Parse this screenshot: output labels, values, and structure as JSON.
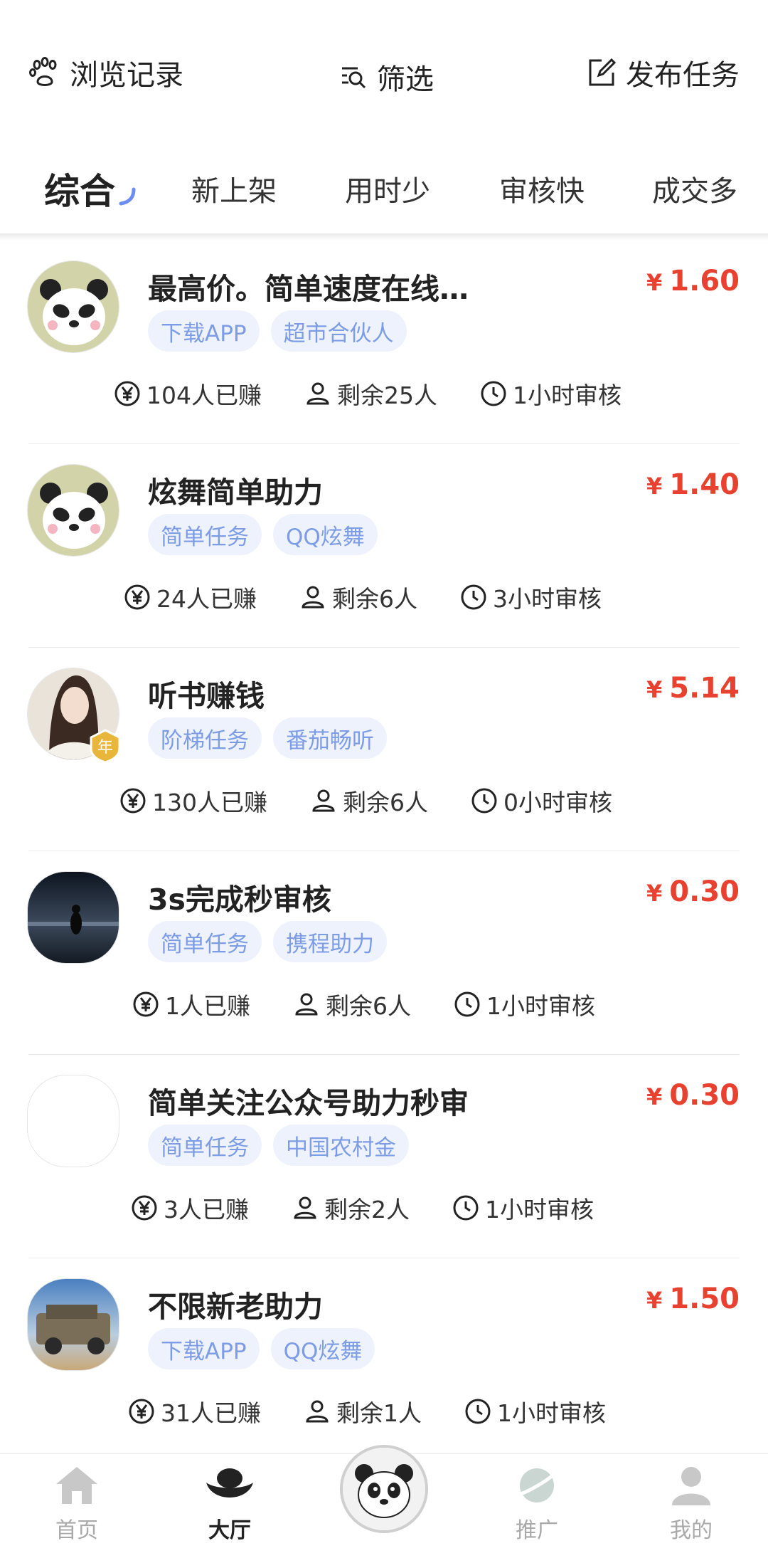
{
  "topbar": {
    "history_label": "浏览记录",
    "filter_label": "筛选",
    "publish_label": "发布任务"
  },
  "tabs": [
    {
      "label": "综合",
      "active": true
    },
    {
      "label": "新上架",
      "active": false
    },
    {
      "label": "用时少",
      "active": false
    },
    {
      "label": "审核快",
      "active": false
    },
    {
      "label": "成交多",
      "active": false
    }
  ],
  "currency_symbol": "¥",
  "tasks": [
    {
      "title": "最高价。简单速度在线…",
      "price": "1.60",
      "tags": [
        "下载APP",
        "超市合伙人"
      ],
      "earned": "104人已赚",
      "remaining": "剩余25人",
      "review": "1小时审核",
      "avatar": "panda"
    },
    {
      "title": "炫舞简单助力",
      "price": "1.40",
      "tags": [
        "简单任务",
        "QQ炫舞"
      ],
      "earned": "24人已赚",
      "remaining": "剩余6人",
      "review": "3小时审核",
      "avatar": "panda"
    },
    {
      "title": "听书赚钱",
      "price": "5.14",
      "tags": [
        "阶梯任务",
        "番茄畅听"
      ],
      "earned": "130人已赚",
      "remaining": "剩余6人",
      "review": "0小时审核",
      "avatar": "girl-photo",
      "badge": "vip-badge"
    },
    {
      "title": "3s完成秒审核",
      "price": "0.30",
      "tags": [
        "简单任务",
        "携程助力"
      ],
      "earned": "1人已赚",
      "remaining": "剩余6人",
      "review": "1小时审核",
      "avatar": "night-sky-photo"
    },
    {
      "title": "简单关注公众号助力秒审",
      "price": "0.30",
      "tags": [
        "简单任务",
        "中国农村金"
      ],
      "earned": "3人已赚",
      "remaining": "剩余2人",
      "review": "1小时审核",
      "avatar": "blank"
    },
    {
      "title": "不限新老助力",
      "price": "1.50",
      "tags": [
        "下载APP",
        "QQ炫舞"
      ],
      "earned": "31人已赚",
      "remaining": "剩余1人",
      "review": "1小时审核",
      "avatar": "car-photo"
    }
  ],
  "bottom_nav": [
    {
      "label": "首页",
      "icon": "home-icon",
      "active": false
    },
    {
      "label": "大厅",
      "icon": "ingot-icon",
      "active": true
    },
    {
      "label": "",
      "icon": "panda-center-icon",
      "active": false
    },
    {
      "label": "推广",
      "icon": "planet-icon",
      "active": false
    },
    {
      "label": "我的",
      "icon": "user-icon",
      "active": false
    }
  ],
  "colors": {
    "price": "#e8412f",
    "tag_bg": "#eef2fd",
    "tag_text": "#7d9ce6",
    "active_arc": "#6d8ef0"
  }
}
